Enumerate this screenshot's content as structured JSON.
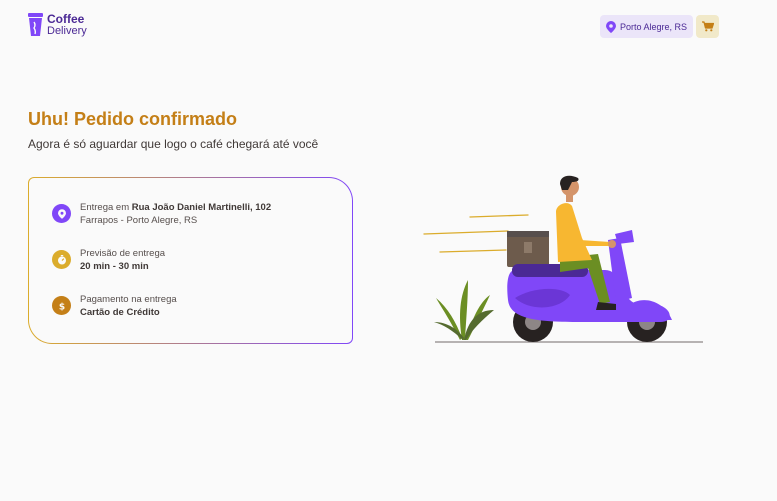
{
  "header": {
    "logo_line1": "Coffee",
    "logo_line2": "Delivery",
    "location": "Porto Alegre, RS",
    "icons": {
      "location": "map-pin-icon",
      "cart": "shopping-cart-icon"
    }
  },
  "main": {
    "title": "Uhu! Pedido confirmado",
    "subtitle": "Agora é só aguardar que logo o café chegará até você"
  },
  "order": {
    "delivery_prefix": "Entrega em ",
    "delivery_street": "Rua João Daniel Martinelli, 102",
    "delivery_district": "Farrapos - Porto Alegre, RS",
    "forecast_label": "Previsão de entrega",
    "forecast_value": "20 min - 30 min",
    "payment_label": "Pagamento na entrega",
    "payment_value": "Cartão de Crédito",
    "icons": {
      "delivery": "map-pin-icon",
      "forecast": "timer-icon",
      "payment": "currency-dollar-icon"
    }
  },
  "colors": {
    "purple": "#8047f8",
    "purple_dark": "#4b2995",
    "purple_light": "#ebe5f9",
    "yellow": "#dbac2c",
    "yellow_dark": "#c47f17",
    "yellow_light": "#f1e9c9",
    "background": "#fafafa",
    "text": "#403937"
  },
  "illustration": "delivery-scooter-illustration"
}
